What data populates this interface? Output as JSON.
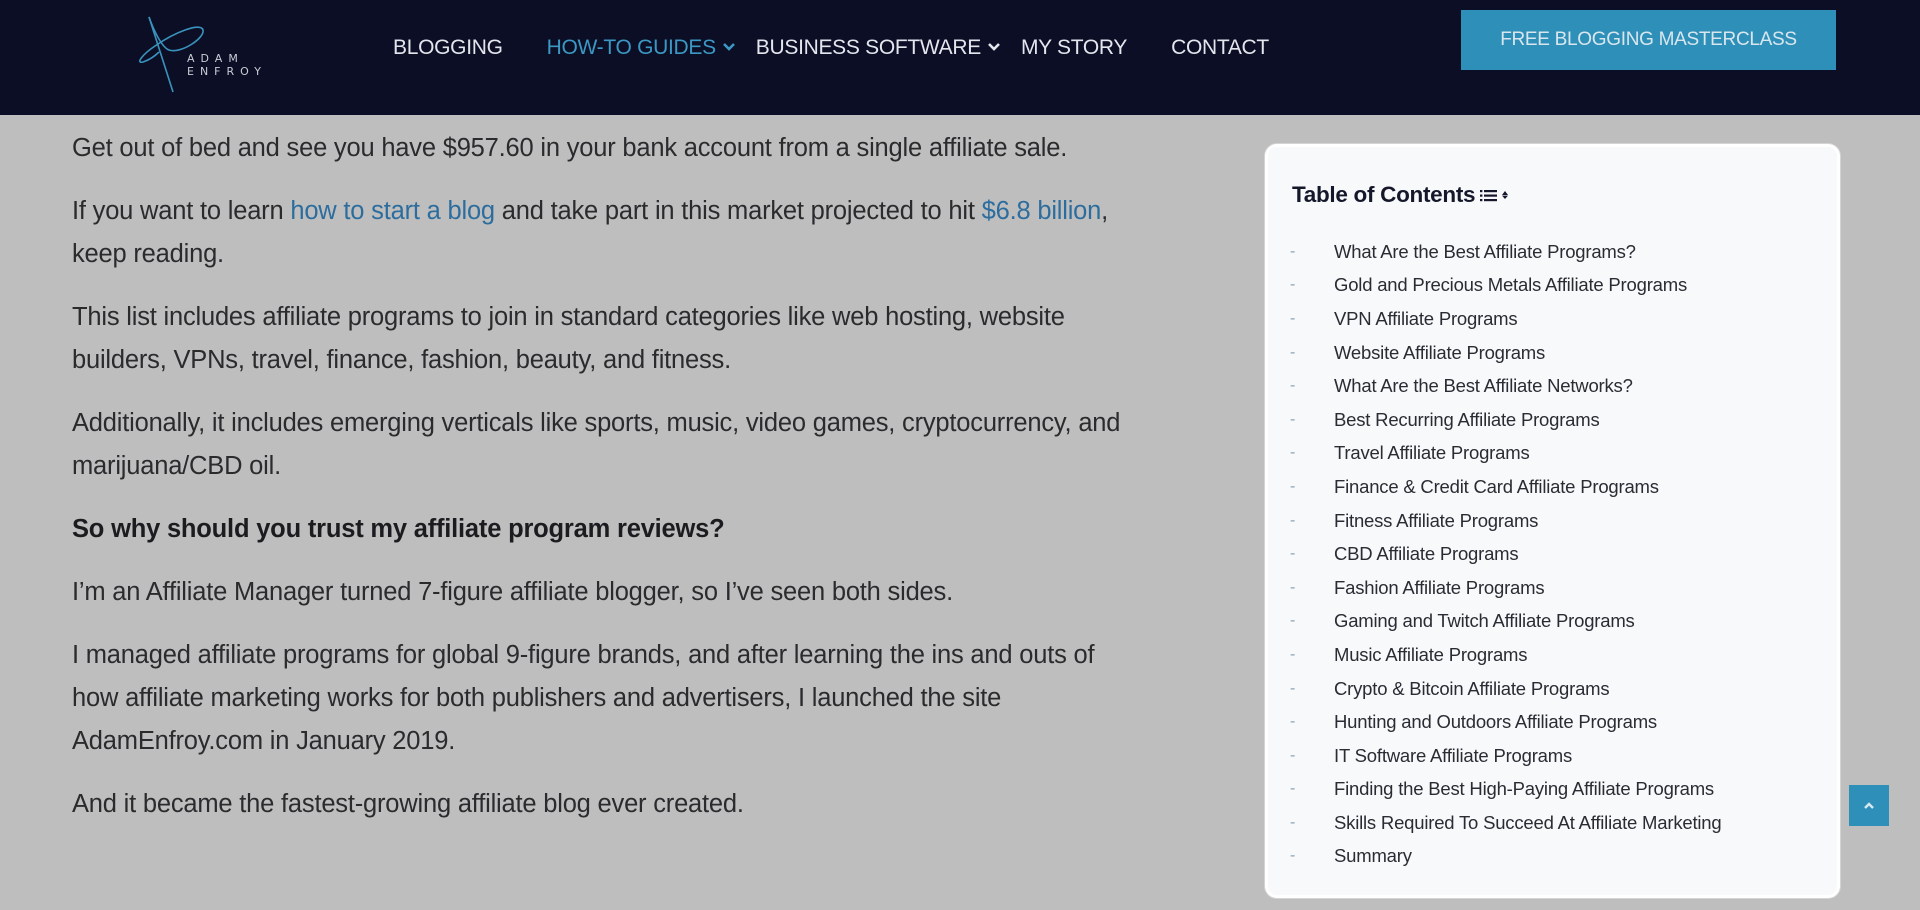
{
  "header": {
    "logo": {
      "line1": "ADAM",
      "line2": "ENFROY"
    },
    "nav": [
      {
        "label": "BLOGGING",
        "active": false,
        "dropdown": false
      },
      {
        "label": "HOW-TO GUIDES",
        "active": true,
        "dropdown": true
      },
      {
        "label": "BUSINESS SOFTWARE",
        "active": false,
        "dropdown": true
      },
      {
        "label": "MY STORY",
        "active": false,
        "dropdown": false
      },
      {
        "label": "CONTACT",
        "active": false,
        "dropdown": false
      }
    ],
    "cta_label": "FREE BLOGGING MASTERCLASS"
  },
  "article": {
    "p1": "Get out of bed and see you have $957.60 in your bank account from a single affiliate sale.",
    "p2": {
      "before": "If you want to learn ",
      "link1": "how to start a blog",
      "middle": " and take part in this market projected to hit ",
      "link2": "$6.8 billion",
      "after": ", keep reading."
    },
    "p3": "This list includes affiliate programs to join in standard categories like web hosting, website builders, VPNs, travel, finance, fashion, beauty, and fitness.",
    "p4": "Additionally, it includes emerging verticals like sports, music, video games, cryptocurrency, and marijuana/CBD oil.",
    "heading": "So why should you trust my affiliate program reviews?",
    "p5": "I’m an Affiliate Manager turned 7-figure affiliate blogger, so I’ve seen both sides.",
    "p6": "I managed affiliate programs for global 9-figure brands, and after learning the ins and outs of how affiliate marketing works for both publishers and advertisers, I launched the site AdamEnfroy.com in January 2019.",
    "p7": "And it became the fastest-growing affiliate blog ever created."
  },
  "toc": {
    "title": "Table of Contents",
    "dash": "-",
    "items": [
      "What Are the Best Affiliate Programs?",
      "Gold and Precious Metals Affiliate Programs",
      "VPN Affiliate Programs",
      "Website Affiliate Programs",
      "What Are the Best Affiliate Networks?",
      "Best Recurring Affiliate Programs",
      "Travel Affiliate Programs",
      "Finance & Credit Card Affiliate Programs",
      "Fitness Affiliate Programs",
      "CBD Affiliate Programs",
      "Fashion Affiliate Programs",
      "Gaming and Twitch Affiliate Programs",
      "Music Affiliate Programs",
      "Crypto & Bitcoin Affiliate Programs",
      "Hunting and Outdoors Affiliate Programs",
      "IT Software Affiliate Programs",
      "Finding the Best High-Paying Affiliate Programs",
      "Skills Required To Succeed At Affiliate Marketing",
      "Summary"
    ]
  },
  "colors": {
    "header_bg": "#0b0e24",
    "accent": "#2e90b8",
    "link": "#2d6d9e",
    "page_bg": "#bebebe"
  }
}
